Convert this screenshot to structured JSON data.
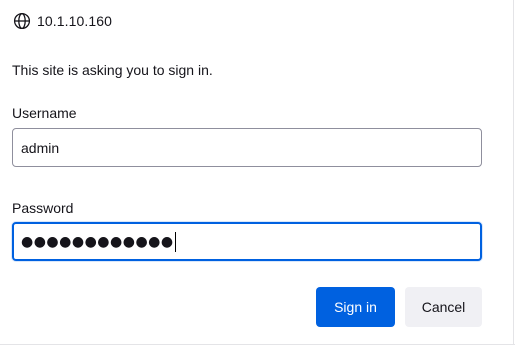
{
  "dialog": {
    "host": "10.1.10.160",
    "message": "This site is asking you to sign in.",
    "username": {
      "label": "Username",
      "value": "admin"
    },
    "password": {
      "label": "Password",
      "masked_value": "●●●●●●●●●●●●",
      "focused": true
    },
    "buttons": {
      "signin_label": "Sign in",
      "cancel_label": "Cancel"
    },
    "icons": {
      "site": "globe-icon"
    },
    "colors": {
      "primary": "#0061e0",
      "secondary_button_bg": "#f0f0f4",
      "text": "#15141a",
      "field_border": "#8f8f9d"
    }
  }
}
